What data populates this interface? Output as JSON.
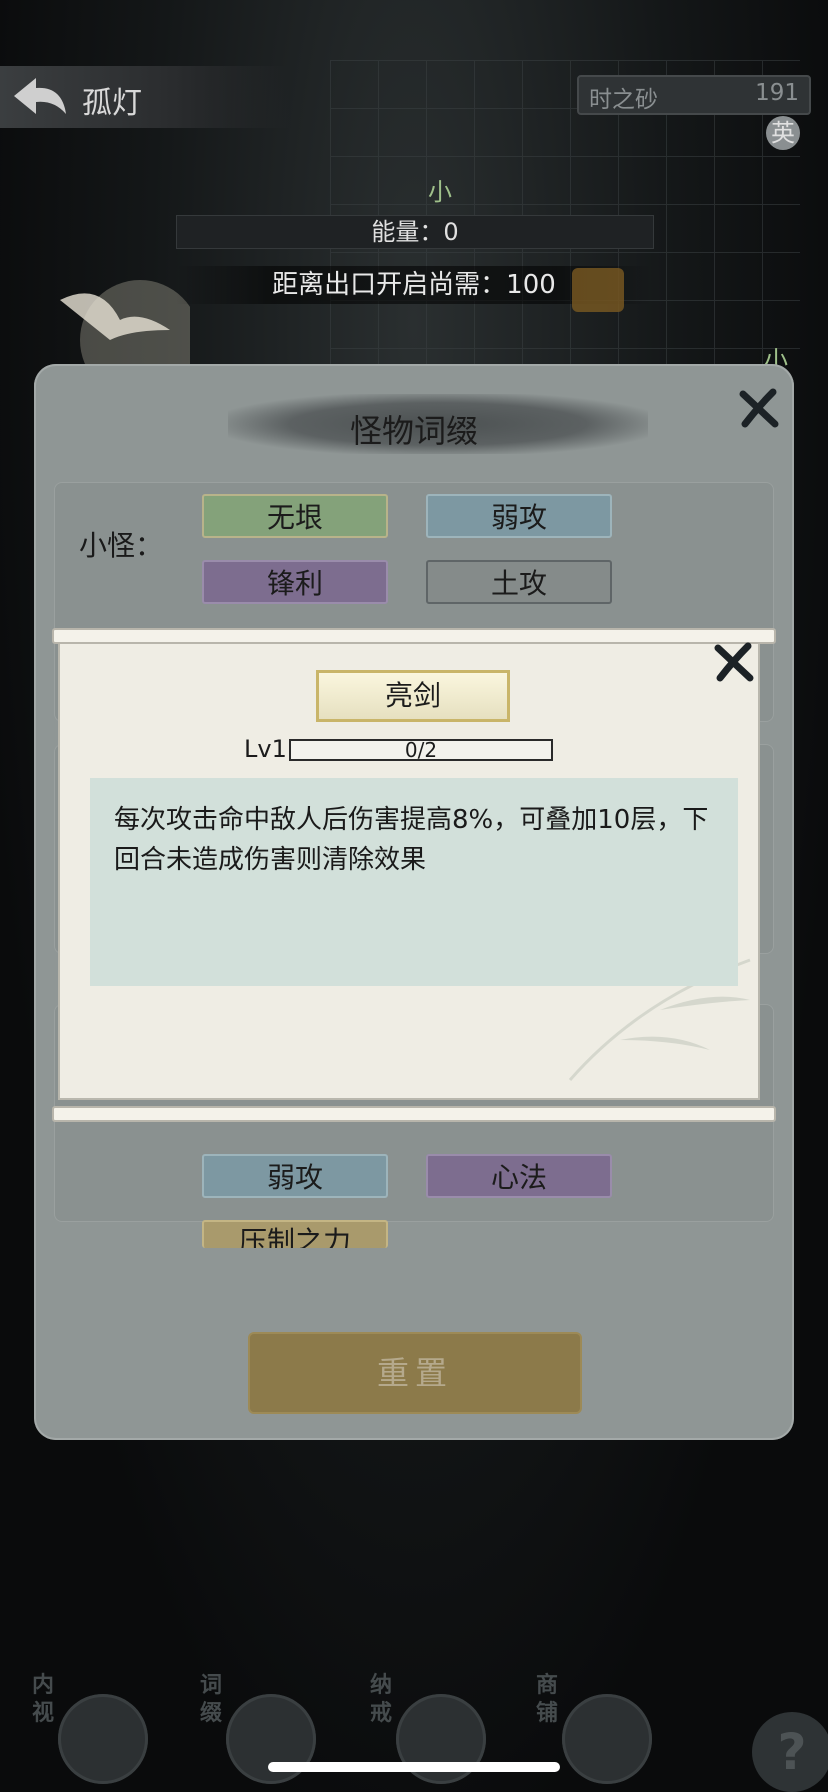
{
  "header": {
    "back_title": "孤灯",
    "currency_label": "时之砂",
    "currency_value": "191"
  },
  "map": {
    "energy_text": "能量：0",
    "exit_text": "距离出口开启尚需：100",
    "marks": [
      "小",
      "英",
      "小"
    ]
  },
  "modal": {
    "title": "怪物词缀",
    "category_minor": "小怪：",
    "tags_top": [
      {
        "label": "无垠",
        "color": "green"
      },
      {
        "label": "弱攻",
        "color": "blue"
      },
      {
        "label": "锋利",
        "color": "purple"
      },
      {
        "label": "土攻",
        "color": "gray"
      }
    ],
    "tags_bottom": [
      {
        "label": "弱攻",
        "color": "blue"
      },
      {
        "label": "心法",
        "color": "purple"
      },
      {
        "label": "压制之力",
        "color": "gold"
      }
    ],
    "reset_label": "重置"
  },
  "skill_detail": {
    "name": "亮剑",
    "level_label": "Lv1",
    "progress_text": "0/2",
    "progress_fraction": 0,
    "description": "每次攻击命中敌人后伤害提高8%，可叠加10层，下回合未造成伤害则清除效果"
  },
  "bottom_nav": [
    {
      "label": "内视",
      "icon": "eye-icon"
    },
    {
      "label": "词缀",
      "icon": "demon-mask-icon"
    },
    {
      "label": "纳戒",
      "icon": "ring-icon"
    },
    {
      "label": "商铺",
      "icon": "shop-icon"
    }
  ],
  "help_label": "?"
}
